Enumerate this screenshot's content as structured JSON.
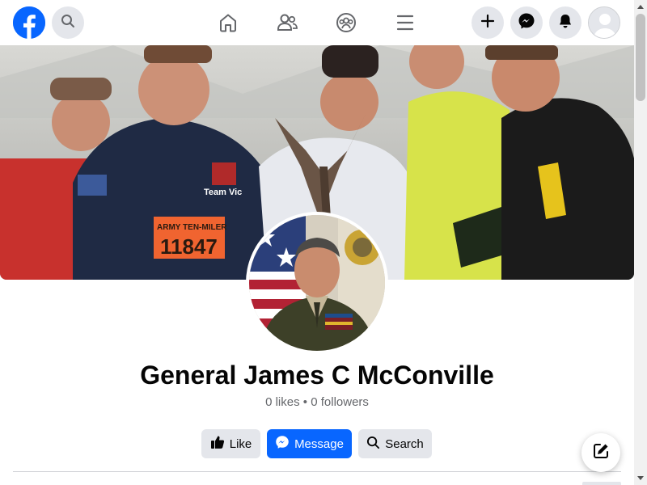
{
  "header": {
    "logo_icon": "facebook-logo-icon",
    "search_icon": "search-icon",
    "nav_icons": [
      "home-icon",
      "friends-icon",
      "groups-icon",
      "menu-icon"
    ],
    "right_icons": [
      "plus-icon",
      "messenger-icon",
      "notifications-icon",
      "account-avatar-icon"
    ]
  },
  "cover": {
    "bib_text": "ARMY TEN-MILER",
    "bib_number": "11847",
    "shirt_text": "Team Vic"
  },
  "profile": {
    "name": "General James C McConville",
    "stats": {
      "likes": "0 likes",
      "separator": "•",
      "followers": "0 followers"
    }
  },
  "actions": {
    "like_label": "Like",
    "message_label": "Message",
    "search_label": "Search"
  },
  "colors": {
    "brand_blue": "#0866ff",
    "button_gray": "#e4e6eb",
    "text_primary": "#050505",
    "text_secondary": "#65676b"
  }
}
